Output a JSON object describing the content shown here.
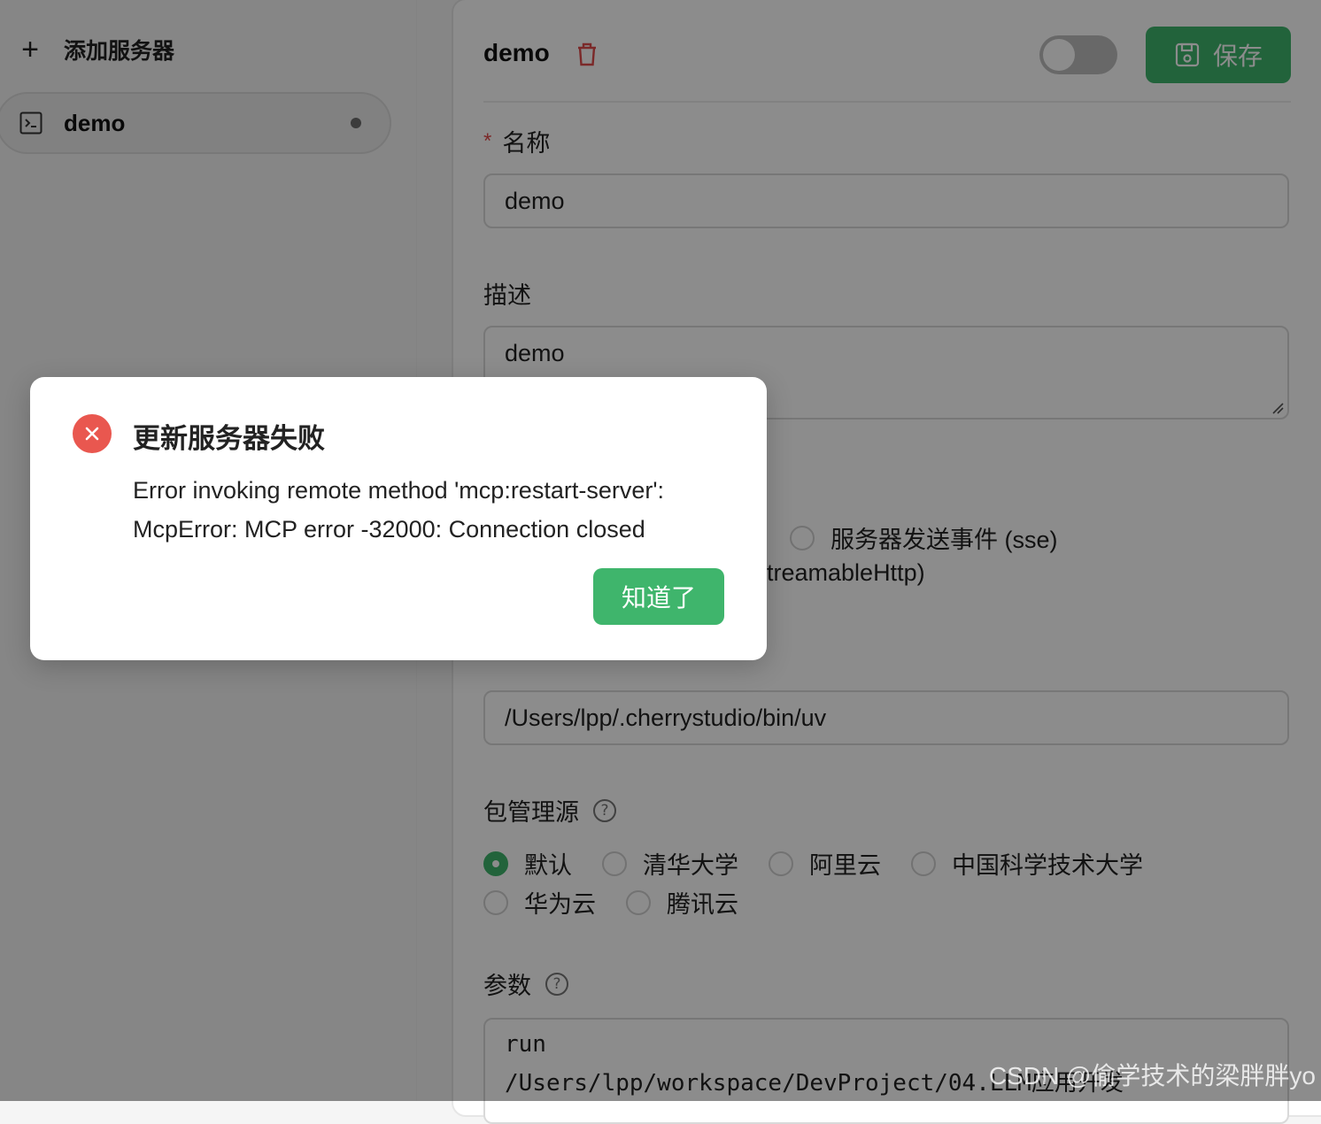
{
  "sidebar": {
    "add_label": "添加服务器",
    "items": [
      {
        "label": "demo"
      }
    ]
  },
  "header": {
    "title": "demo",
    "save_label": "保存"
  },
  "form": {
    "name": {
      "label": "名称",
      "required_mark": "*",
      "value": "demo"
    },
    "description": {
      "label": "描述",
      "value": "demo"
    },
    "type": {
      "options": [
        {
          "label": "服务器发送事件 (sse)"
        },
        {
          "label": "treamableHttp)"
        }
      ]
    },
    "command": {
      "value": "/Users/lpp/.cherrystudio/bin/uv"
    },
    "registry": {
      "label": "包管理源",
      "options": [
        {
          "label": "默认",
          "checked": true
        },
        {
          "label": "清华大学",
          "checked": false
        },
        {
          "label": "阿里云",
          "checked": false
        },
        {
          "label": "中国科学技术大学",
          "checked": false
        },
        {
          "label": "华为云",
          "checked": false
        },
        {
          "label": "腾讯云",
          "checked": false
        }
      ]
    },
    "args": {
      "label": "参数",
      "line1": "run",
      "line2": "/Users/lpp/workspace/DevProject/04.LLM应用开发"
    }
  },
  "dialog": {
    "title": "更新服务器失败",
    "message_line1": "Error invoking remote method 'mcp:restart-server':",
    "message_line2": "McpError: MCP error -32000: Connection closed",
    "ok_label": "知道了"
  },
  "watermark": "CSDN @偷学技术的梁胖胖yo",
  "colors": {
    "accent": "#3fb56c",
    "error": "#e9574f"
  }
}
